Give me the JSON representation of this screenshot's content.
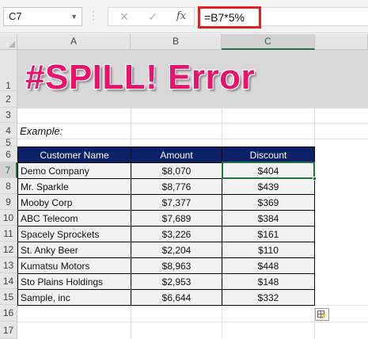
{
  "formula_bar": {
    "name_box": "C7",
    "name_box_icon": "chevron-down-icon",
    "cancel_icon": "✕",
    "enter_icon": "✓",
    "fx_label": "fx",
    "formula": "=B7*5%"
  },
  "columns": [
    "A",
    "B",
    "C"
  ],
  "selected_column": "C",
  "rows": [
    "1",
    "2",
    "3",
    "4",
    "5",
    "6",
    "7",
    "8",
    "9",
    "10",
    "11",
    "12",
    "13",
    "14",
    "15",
    "16",
    "17"
  ],
  "selected_row": "7",
  "sheet": {
    "banner_title": "#SPILL! Error",
    "example_label": "Example:"
  },
  "table": {
    "headers": [
      "Customer Name",
      "Amount",
      "Discount"
    ],
    "rows": [
      [
        "Demo Company",
        "$8,070",
        "$404"
      ],
      [
        "Mr. Sparkle",
        "$8,776",
        "$439"
      ],
      [
        "Mooby Corp",
        "$7,377",
        "$369"
      ],
      [
        "ABC Telecom",
        "$7,689",
        "$384"
      ],
      [
        "Spacely Sprockets",
        "$3,226",
        "$161"
      ],
      [
        "St. Anky Beer",
        "$2,204",
        "$110"
      ],
      [
        "Kumatsu Motors",
        "$8,963",
        "$448"
      ],
      [
        "Sto Plains Holdings",
        "$2,953",
        "$148"
      ],
      [
        "Sample, inc",
        "$6,644",
        "$332"
      ]
    ]
  },
  "colors": {
    "banner_text": "#e8146c",
    "table_header_bg": "#0d2266",
    "selection": "#217346",
    "formula_highlight": "#e2211c"
  }
}
